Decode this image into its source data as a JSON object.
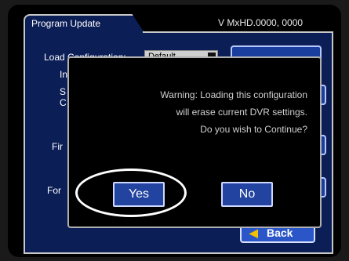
{
  "header": {
    "tab_title": "Program Update",
    "version": "V MxHD.0000, 0000"
  },
  "background": {
    "load_configuration_label": "Load Configuration:",
    "load_configuration_value": "Default",
    "partial_labels": [
      "In",
      "S",
      "C",
      "Fir",
      "For"
    ],
    "back_label": "Back"
  },
  "dialog": {
    "message_lines": [
      "Warning: Loading this configuration",
      "will erase current DVR settings.",
      "Do you wish to Continue?"
    ],
    "yes_label": "Yes",
    "no_label": "No"
  },
  "colors": {
    "panel_blue": "#0c1e56",
    "button_blue": "#2244a0",
    "highlight_oval": "#ffffff"
  },
  "icons": {
    "back": "left-arrow-icon"
  }
}
